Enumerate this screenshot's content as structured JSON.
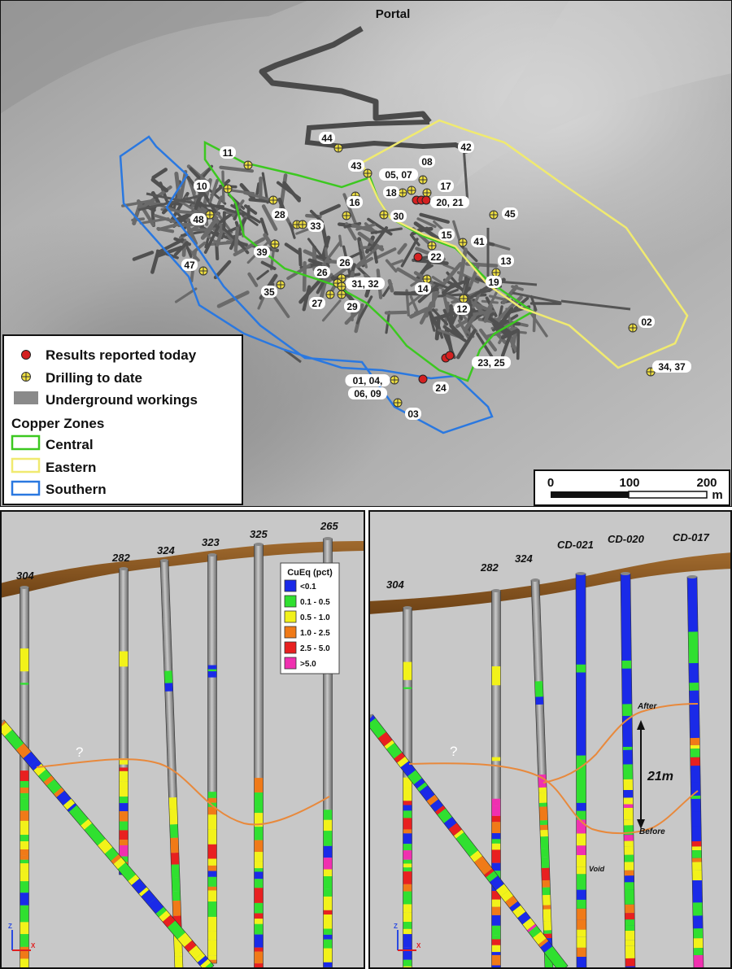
{
  "map": {
    "portal_label": "Portal",
    "legend": {
      "results_label": "Results reported today",
      "drilling_label": "Drilling to date",
      "workings_label": "Underground workings",
      "zones_title": "Copper Zones",
      "zones": [
        {
          "name": "Central",
          "color": "#3cc820"
        },
        {
          "name": "Eastern",
          "color": "#f0ea70"
        },
        {
          "name": "Southern",
          "color": "#2a78e0"
        }
      ]
    },
    "scale": {
      "ticks": [
        "0",
        "100",
        "200"
      ],
      "unit": "m"
    },
    "hole_labels": [
      "44",
      "42",
      "11",
      "08",
      "43",
      "05, 07",
      "17",
      "10",
      "18",
      "20, 21",
      "16",
      "28",
      "33",
      "30",
      "45",
      "48",
      "15",
      "41",
      "39",
      "22",
      "47",
      "26",
      "13",
      "26",
      "31, 32",
      "19",
      "35",
      "14",
      "27",
      "29",
      "12",
      "02",
      "23, 25",
      "01, 04,",
      "06, 09",
      "24",
      "34, 37",
      "03"
    ],
    "colors": {
      "results": "#d42020",
      "drilling": "#f0e040",
      "workings": "#555555"
    }
  },
  "cueq_legend": {
    "title": "CuEq (pct)",
    "items": [
      {
        "label": "<0.1",
        "color": "#1a2ae8"
      },
      {
        "label": "0.1 - 0.5",
        "color": "#30e030"
      },
      {
        "label": "0.5 - 1.0",
        "color": "#f2f21a"
      },
      {
        "label": "1.0 - 2.5",
        "color": "#f07a18"
      },
      {
        "label": "2.5 - 5.0",
        "color": "#e82020"
      },
      {
        "label": ">5.0",
        "color": "#f030b0"
      }
    ]
  },
  "section_left": {
    "hole_labels": [
      "304",
      "282",
      "324",
      "323",
      "325",
      "265"
    ],
    "question_mark": "?"
  },
  "section_right": {
    "hole_labels": [
      "304",
      "282",
      "324",
      "CD-021",
      "CD-020",
      "CD-017"
    ],
    "question_mark": "?",
    "after_label": "After",
    "before_label": "Before",
    "thickness_label": "21m",
    "void_label": "Void"
  }
}
